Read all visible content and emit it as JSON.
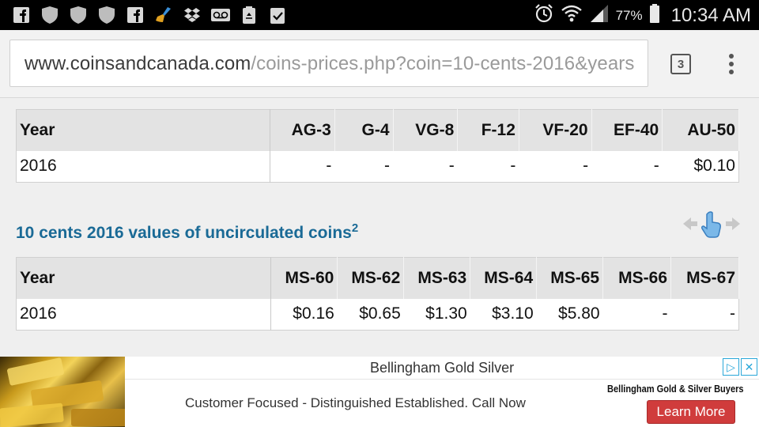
{
  "status_bar": {
    "battery_pct": "77%",
    "time": "10:34 AM",
    "left_icons": [
      "facebook-icon",
      "shield-icon",
      "shield-icon",
      "shield-icon",
      "facebook-icon",
      "broom-icon",
      "dropbox-icon",
      "voicemail-icon",
      "recycle-icon",
      "clipboard-check-icon"
    ],
    "right_icons": [
      "alarm-icon",
      "wifi-icon",
      "signal-icon",
      "battery-icon"
    ]
  },
  "browser": {
    "url_domain": "www.coinsandcanada.com",
    "url_path": "/coins-prices.php?coin=10-cents-2016&years",
    "tab_count": "3"
  },
  "table_circulated": {
    "headers": [
      "Year",
      "AG-3",
      "G-4",
      "VG-8",
      "F-12",
      "VF-20",
      "EF-40",
      "AU-50"
    ],
    "rows": [
      [
        "2016",
        "-",
        "-",
        "-",
        "-",
        "-",
        "-",
        "$0.10"
      ]
    ]
  },
  "section": {
    "title": "10 cents 2016 values of uncirculated coins",
    "footnote": "2"
  },
  "table_uncirculated": {
    "headers": [
      "Year",
      "MS-60",
      "MS-62",
      "MS-63",
      "MS-64",
      "MS-65",
      "MS-66",
      "MS-67"
    ],
    "rows": [
      [
        "2016",
        "$0.16",
        "$0.65",
        "$1.30",
        "$3.10",
        "$5.80",
        "-",
        "-"
      ]
    ]
  },
  "ad": {
    "title": "Bellingham Gold Silver",
    "body": "Customer Focused - Distinguished Established. Call Now",
    "brand": "Bellingham Gold & Silver Buyers",
    "cta": "Learn More"
  },
  "colors": {
    "section_title": "#1a6a96",
    "cta": "#d03c3c",
    "adchoices": "#2aa7d9"
  }
}
